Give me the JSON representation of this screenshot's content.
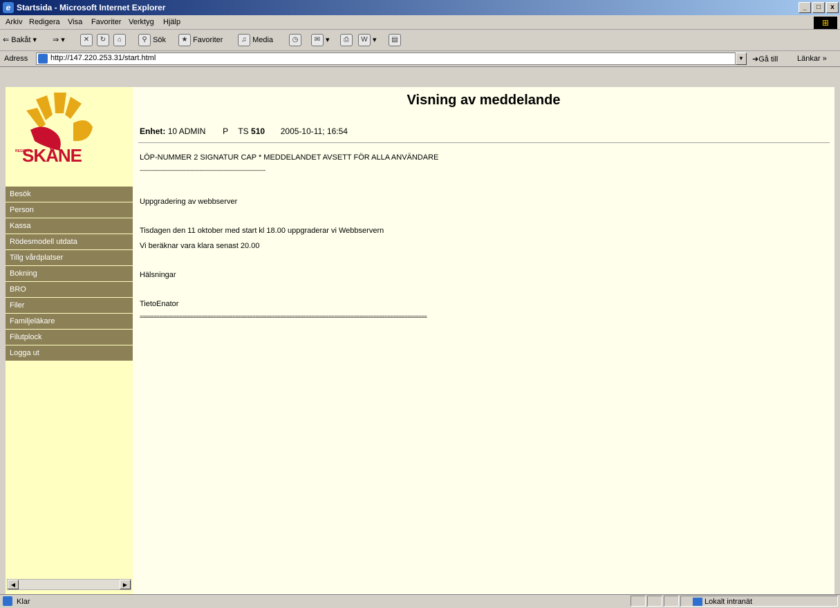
{
  "window": {
    "title": "Startsida - Microsoft Internet Explorer",
    "btn_min": "_",
    "btn_max": "□",
    "btn_close": "x"
  },
  "menu": [
    "Arkiv",
    "Redigera",
    "Visa",
    "Favoriter",
    "Verktyg",
    "Hjälp"
  ],
  "toolbar": {
    "back": "Bakåt",
    "search": "Sök",
    "favorites": "Favoriter",
    "media": "Media"
  },
  "address": {
    "label": "Adress",
    "url": "http://147.220.253.31/start.html",
    "go": "Gå till",
    "links": "Länkar »"
  },
  "sidebar": {
    "logo_region": "REGION",
    "logo_text": "SKÅNE",
    "items": [
      "Besök",
      "Person",
      "Kassa",
      "Rödesmodell utdata",
      "Tillg vårdplatser",
      "Bokning",
      "BRO",
      "Filer",
      "Familjeläkare",
      "Filutplock",
      "Logga ut"
    ]
  },
  "main": {
    "heading": "Visning av meddelande",
    "enhet_label": "Enhet:",
    "enhet_value": "10 ADMIN",
    "p_label": "P",
    "ts_label": "TS",
    "ts_value": "510",
    "datetime": "2005-10-11; 16:54",
    "line1": "LÖP-NUMMER 2 SIGNATUR CAP * MEDDELANDET AVSETT FÖR ALLA ANVÄNDARE",
    "dashes_short": "------------------------------------------------------------------------------------",
    "subject": "Uppgradering av webbserver",
    "body1": "Tisdagen den 11 oktober med start kl 18.00 uppgraderar vi Webbservern",
    "body2": "Vi beräknar vara klara senast 20.00",
    "greeting": "Hälsningar",
    "signature": "TietoEnator",
    "dashes_long": "======================================================================================================"
  },
  "status": {
    "text": "Klar",
    "zone": "Lokalt intranät"
  },
  "colors": {
    "nav_bg": "#8c8056",
    "sidebar_bg": "#ffffc2",
    "main_bg": "#ffffec",
    "logo_yellow": "#e6a817",
    "logo_red": "#c8102e"
  }
}
